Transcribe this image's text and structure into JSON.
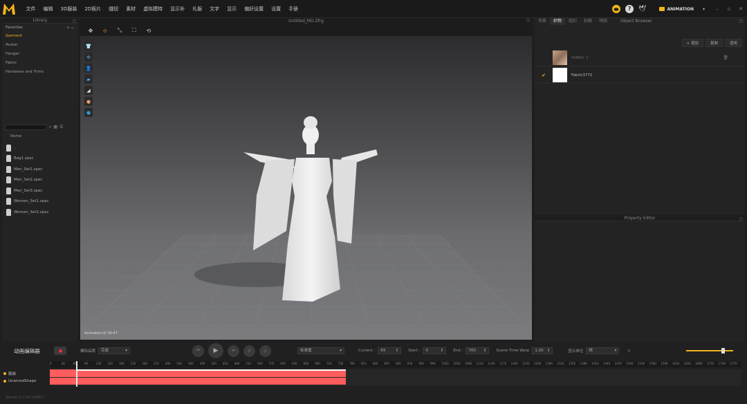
{
  "menubar": {
    "items": [
      "文件",
      "编辑",
      "3D服装",
      "2D板片",
      "缝纫",
      "素材",
      "虚拟模特",
      "显示补",
      "礼服",
      "文字",
      "显示",
      "偏好设置",
      "设置",
      "手册"
    ],
    "right_text": "",
    "mode_label": "ANIMATION"
  },
  "library": {
    "title": "Library",
    "favorites_label": "Favorites",
    "items": [
      {
        "label": "Garment",
        "active": true
      },
      {
        "label": "Avatar",
        "active": false
      },
      {
        "label": "Hanger",
        "active": false
      },
      {
        "label": "Fabric",
        "active": false
      },
      {
        "label": "Hardware and Trims",
        "active": false
      }
    ],
    "name_header": "Name",
    "files": [
      "..",
      "Bag1.zpac",
      "Men_Set1.zpac",
      "Men_Set2.zpac",
      "Men_Set3.zpac",
      "Women_Set1.zpac",
      "Women_Set2.zpac"
    ]
  },
  "viewport": {
    "title": "Untitled_MD.Zfrg",
    "status": "Animation:0/ 00:47"
  },
  "object_browser": {
    "title": "Object Browser",
    "tabs": [
      "场景",
      "织物",
      "纽扣",
      "扣眼",
      "明线"
    ],
    "active_tab": 1,
    "add_button": "+ 增加",
    "buttons": [
      "复制",
      "适用"
    ],
    "fabrics": [
      {
        "name": "FABRIC 1",
        "checked": false,
        "dim": true
      },
      {
        "name": "Fabric3772",
        "checked": true,
        "dim": false
      }
    ]
  },
  "property_editor": {
    "title": "Property Editor"
  },
  "animation": {
    "title": "动画编辑器",
    "record_label": "模拟品质",
    "record_value": "完成",
    "speed_value": "标准值",
    "current_label": "Current :",
    "current_value": "69",
    "start_label": "Start :",
    "start_value": "0",
    "end_label": "End :",
    "end_value": "700",
    "warp_label": "Scene Time Warp",
    "warp_value": "1.00",
    "unit_label": "显示单位",
    "unit_value": "帧",
    "ticks": [
      "0",
      "30",
      "60",
      "90",
      "120",
      "150",
      "180",
      "210",
      "240",
      "270",
      "300",
      "330",
      "360",
      "390",
      "420",
      "450",
      "480",
      "510",
      "540",
      "570",
      "600",
      "630",
      "660",
      "690",
      "720",
      "750",
      "780",
      "810",
      "840",
      "870",
      "900",
      "930",
      "960",
      "990",
      "1020",
      "1050",
      "1080",
      "1110",
      "1140",
      "1170",
      "1200",
      "1230",
      "1260",
      "1290",
      "1320",
      "1350",
      "1380",
      "1410",
      "1440",
      "1470",
      "1500",
      "1530",
      "1560",
      "1590",
      "1620",
      "1650",
      "1680",
      "1710",
      "1740",
      "1770"
    ],
    "tracks": [
      "服装",
      "UnamedShape"
    ],
    "status": "Version 5.0.93 (r8057)"
  }
}
